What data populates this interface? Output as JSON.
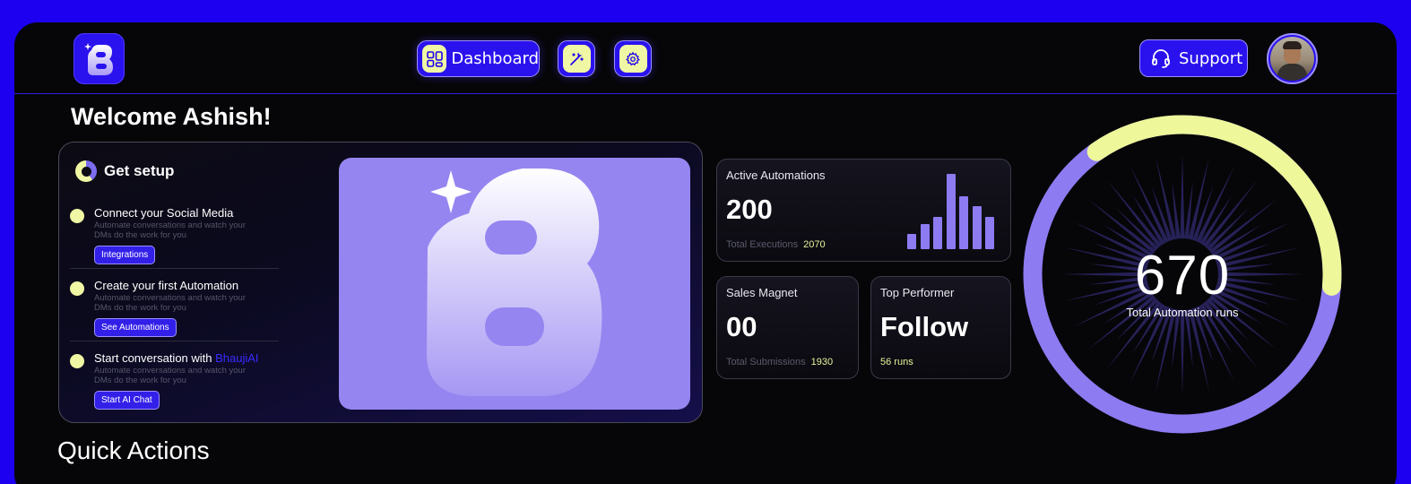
{
  "colors": {
    "brand": "#1d00f0",
    "accent_yellow": "#f0f7a4",
    "accent_purple": "#9585f0",
    "background": "#060608"
  },
  "nav": {
    "dashboard_label": "Dashboard",
    "support_label": "Support"
  },
  "welcome": "Welcome Ashish!",
  "setup": {
    "title": "Get setup",
    "steps": [
      {
        "title": "Connect your Social Media",
        "desc": "Automate conversations and watch your DMs do the work for you",
        "button": "Integrations"
      },
      {
        "title": "Create your first Automation",
        "desc": "Automate conversations and watch your DMs do the work for you",
        "button": "See Automations"
      },
      {
        "title_prefix": "Start conversation with ",
        "title_highlight": "BhaujiAI",
        "desc": "Automate conversations and watch your DMs do the work for you",
        "button": "Start AI Chat"
      }
    ]
  },
  "stats": {
    "active": {
      "label": "Active Automations",
      "value": "200",
      "sub_label": "Total Executions",
      "sub_value": "2070"
    },
    "sales": {
      "label": "Sales Magnet",
      "value": "00",
      "sub_label": "Total Submissions",
      "sub_value": "1930"
    },
    "top": {
      "label": "Top Performer",
      "value": "Follow",
      "sub_value": "56 runs"
    }
  },
  "mini_bars": [
    0.2,
    0.33,
    0.43,
    1.0,
    0.7,
    0.57,
    0.43
  ],
  "gauge": {
    "value": "670",
    "label": "Total Automation runs",
    "yellow_fraction": 0.36
  },
  "quick_actions": "Quick Actions",
  "icons": [
    "logo-icon",
    "grid-icon",
    "magic-wand-icon",
    "gear-icon",
    "headset-icon",
    "sparkle-icon"
  ]
}
